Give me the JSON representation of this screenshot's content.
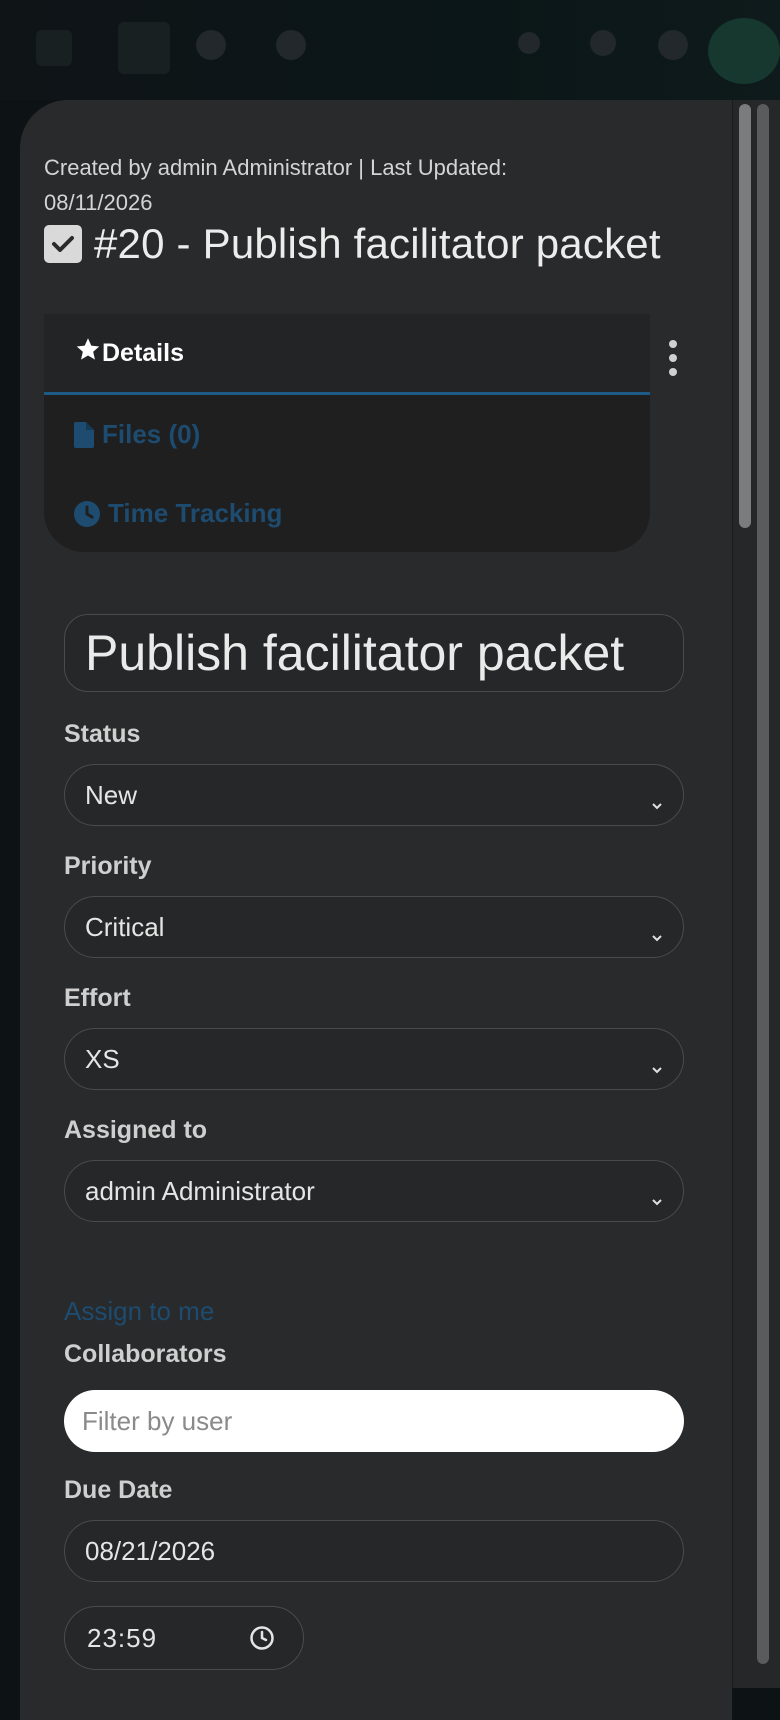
{
  "header": {
    "meta_line1": "Created by admin Administrator | Last Updated:",
    "meta_line2": "08/11/2026",
    "title": "#20 - Publish facilitator packet"
  },
  "tabs": [
    {
      "label": "Details",
      "icon": "star-icon",
      "active": true
    },
    {
      "label": "Files (0)",
      "icon": "file-icon",
      "active": false
    },
    {
      "label": "Time Tracking",
      "icon": "clock-icon",
      "active": false
    }
  ],
  "form": {
    "name_value": "Publish facilitator packet",
    "status_label": "Status",
    "status_value": "New",
    "priority_label": "Priority",
    "priority_value": "Critical",
    "effort_label": "Effort",
    "effort_value": "XS",
    "assigned_label": "Assigned to",
    "assigned_value": "admin Administrator",
    "assign_to_me": "Assign to me",
    "collaborators_label": "Collaborators",
    "collaborators_placeholder": "Filter by user",
    "due_date_label": "Due Date",
    "due_date_value": "08/21/2026",
    "due_time_value": "23:59"
  },
  "colors": {
    "accent_link": "#1d4c70",
    "tab_underline": "#1e5a86",
    "panel_bg": "#292a2b"
  }
}
